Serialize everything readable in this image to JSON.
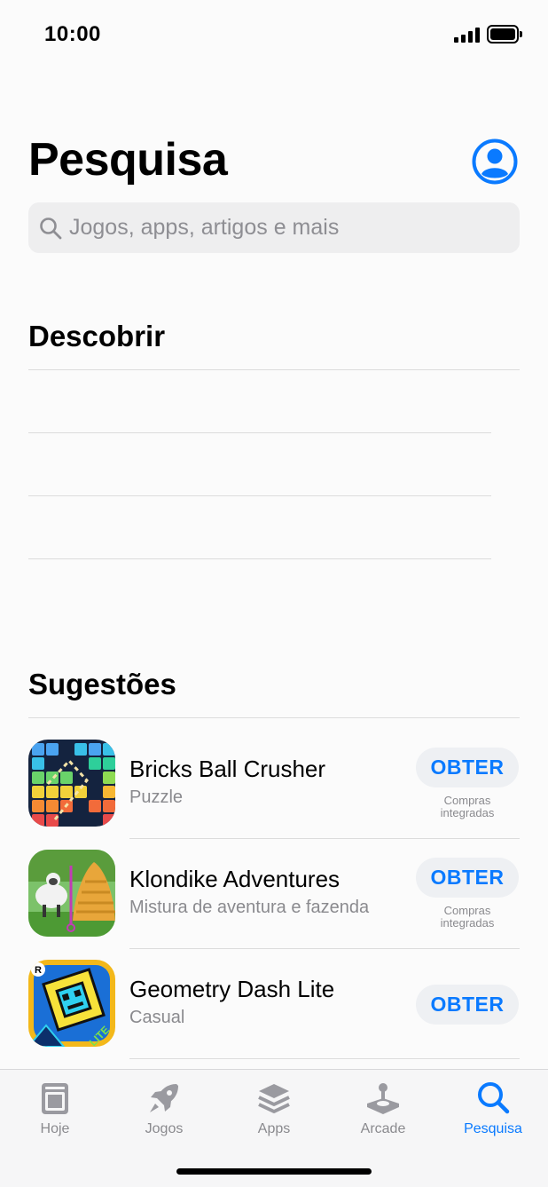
{
  "status": {
    "time": "10:00"
  },
  "header": {
    "title": "Pesquisa"
  },
  "search": {
    "placeholder": "Jogos, apps, artigos e mais"
  },
  "discover": {
    "title": "Descobrir",
    "items": []
  },
  "suggestions": {
    "title": "Sugestões",
    "items": [
      {
        "name": "Bricks Ball Crusher",
        "category": "Puzzle",
        "button": "OBTER",
        "note": "Compras integradas"
      },
      {
        "name": "Klondike Adventures",
        "category": "Mistura de aventura e fazenda",
        "button": "OBTER",
        "note": "Compras integradas"
      },
      {
        "name": "Geometry Dash Lite",
        "category": "Casual",
        "button": "OBTER",
        "note": ""
      }
    ]
  },
  "tabs": [
    {
      "label": "Hoje",
      "icon": "today-icon",
      "active": false
    },
    {
      "label": "Jogos",
      "icon": "rocket-icon",
      "active": false
    },
    {
      "label": "Apps",
      "icon": "layers-icon",
      "active": false
    },
    {
      "label": "Arcade",
      "icon": "joystick-icon",
      "active": false
    },
    {
      "label": "Pesquisa",
      "icon": "search-icon",
      "active": true
    }
  ],
  "colors": {
    "accent": "#0a7aff",
    "secondary_text": "#8a8a8e",
    "tab_inactive": "#8a8a8e"
  }
}
